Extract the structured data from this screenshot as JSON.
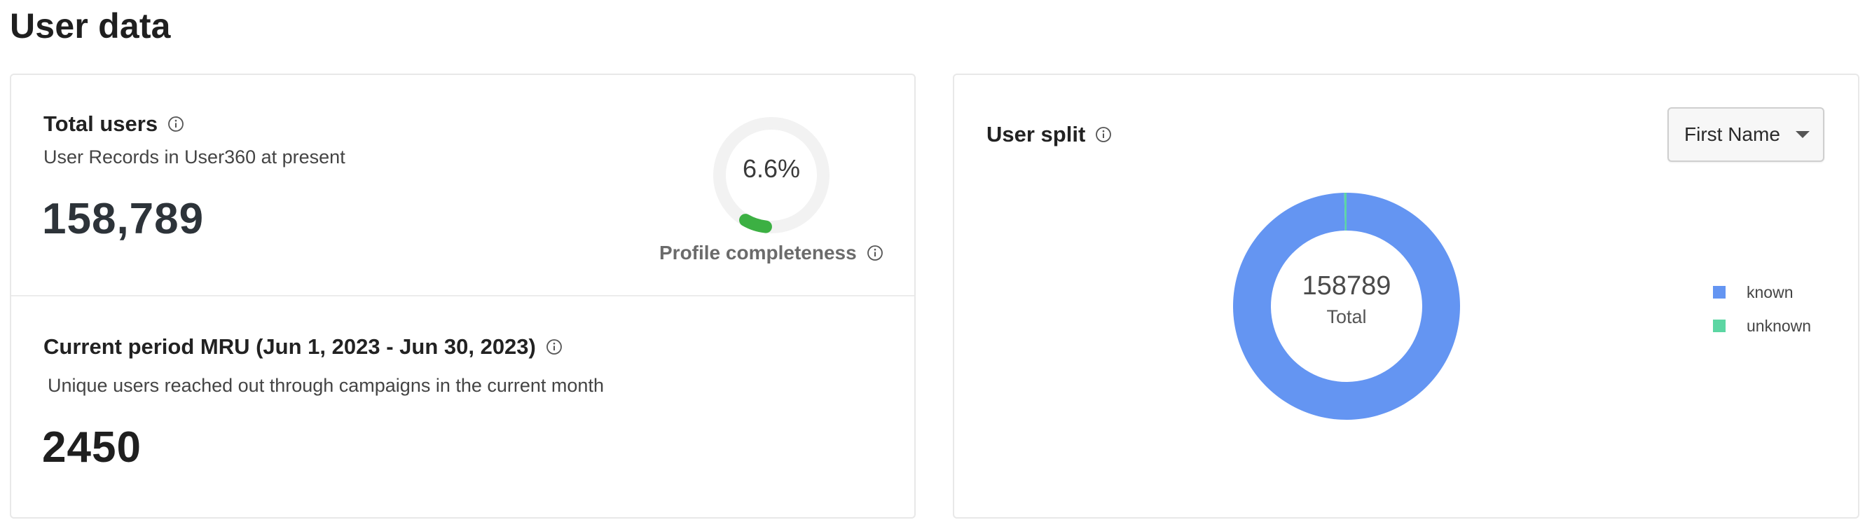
{
  "page": {
    "title": "User data"
  },
  "total_users": {
    "title": "Total users",
    "subtitle": "User Records in User360 at present",
    "value": "158,789",
    "profile_completeness": {
      "value_text": "6.6%",
      "value": 6.6,
      "label": "Profile completeness",
      "color": "#3cb043",
      "track_color": "#f2f2f2"
    }
  },
  "mru": {
    "title": "Current period MRU (Jun 1, 2023 - Jun 30, 2023)",
    "subtitle": "Unique users reached out through campaigns in the current month",
    "value": "2450"
  },
  "user_split": {
    "title": "User split",
    "dropdown": {
      "selected": "First Name"
    },
    "center_value": "158789",
    "center_label": "Total"
  },
  "chart_data": {
    "type": "pie",
    "categories": [
      "known",
      "unknown"
    ],
    "values": [
      158789,
      0
    ],
    "colors": [
      "#6495f2",
      "#5cd6a3"
    ],
    "legend_position": "right"
  },
  "icons": {
    "info": "info-icon",
    "dropdown": "chevron-down-icon"
  }
}
